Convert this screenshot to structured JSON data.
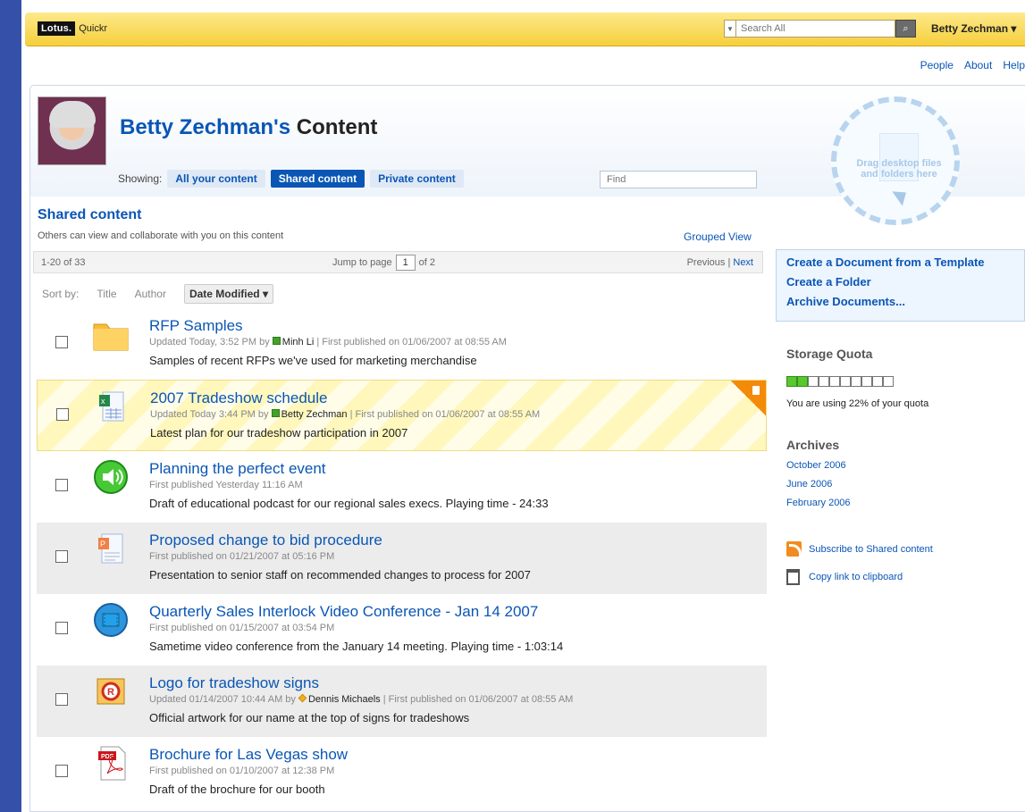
{
  "app": {
    "brand_primary": "Lotus.",
    "brand_secondary": "Quickr",
    "accent": "#0a56b5",
    "background": "#3550a8"
  },
  "search": {
    "placeholder": "Search All",
    "button": "search-icon",
    "dropdown": "chevron-down-icon"
  },
  "user": {
    "name": "Betty Zechman"
  },
  "top_links": [
    "People",
    "About",
    "Help"
  ],
  "header": {
    "title_name": "Betty Zechman's",
    "title_suffix": "Content",
    "showing_label": "Showing:",
    "filters": [
      "All your content",
      "Shared content",
      "Private content"
    ],
    "find_placeholder": "Find"
  },
  "section": {
    "title": "Shared content",
    "description": "Others can view and collaborate with you on this content",
    "grouped_view": "Grouped View"
  },
  "pager": {
    "range": "1-20 of 33",
    "jump_label": "Jump to page",
    "page": "1",
    "of_label": "of 2",
    "previous": "Previous",
    "divider": "|",
    "next": "Next"
  },
  "sort": {
    "label": "Sort by:",
    "title": "Title",
    "author": "Author",
    "date": "Date Modified ▾"
  },
  "items": [
    {
      "title": "RFP Samples",
      "meta_prefix": "Updated Today, 3:52 PM by",
      "author": "Minh Li",
      "meta_suffix": " | First published on 01/06/2007 at 08:55 AM",
      "description": "Samples of recent RFPs we've used for marketing merchandise",
      "icon": "folder-icon"
    },
    {
      "title": "2007 Tradeshow schedule",
      "meta_prefix": "Updated Today 3:44 PM by",
      "author": "Betty Zechman",
      "meta_suffix": " | First published on 01/06/2007 at 08:55 AM",
      "description": "Latest plan for our tradeshow participation in 2007",
      "icon": "spreadsheet-icon"
    },
    {
      "title": "Planning the perfect event",
      "meta_prefix": "First published Yesterday 11:16 AM",
      "author": "",
      "meta_suffix": "",
      "description": "Draft of educational podcast for our regional sales execs. Playing time - 24:33",
      "icon": "audio-icon"
    },
    {
      "title": "Proposed change to bid procedure",
      "meta_prefix": "First published on 01/21/2007 at 05:16 PM",
      "author": "",
      "meta_suffix": "",
      "description": "Presentation to senior staff on recommended changes to process for 2007",
      "icon": "presentation-icon"
    },
    {
      "title": "Quarterly Sales Interlock Video Conference - Jan 14 2007",
      "meta_prefix": "First published on 01/15/2007 at 03:54 PM",
      "author": "",
      "meta_suffix": "",
      "description": "Sametime video conference from the January 14 meeting. Playing time - 1:03:14",
      "icon": "video-icon"
    },
    {
      "title": "Logo for tradeshow signs",
      "meta_prefix": "Updated 01/14/2007 10:44 AM by",
      "author": "Dennis Michaels",
      "meta_suffix": " | First published on 01/06/2007 at 08:55 AM",
      "description": "Official artwork for our name at the top of signs for tradeshows",
      "icon": "image-icon"
    },
    {
      "title": "Brochure for Las Vegas show",
      "meta_prefix": "First published on 01/10/2007 at 12:38 PM",
      "author": "",
      "meta_suffix": "",
      "description": "Draft of the brochure for our booth",
      "icon": "pdf-icon"
    }
  ],
  "sidebar": {
    "drop_text": "Drag desktop files and folders here",
    "actions": [
      "Create a Document from a Template",
      "Create a Folder",
      "Archive Documents..."
    ],
    "storage_title": "Storage Quota",
    "quota_used_fraction": 0.22,
    "quota_text": "You are using 22% of your quota",
    "archives_title": "Archives",
    "archives": [
      "October 2006",
      "June 2006",
      "February 2006"
    ],
    "subscribe": "Subscribe to Shared content",
    "copy_link": "Copy link to clipboard"
  }
}
